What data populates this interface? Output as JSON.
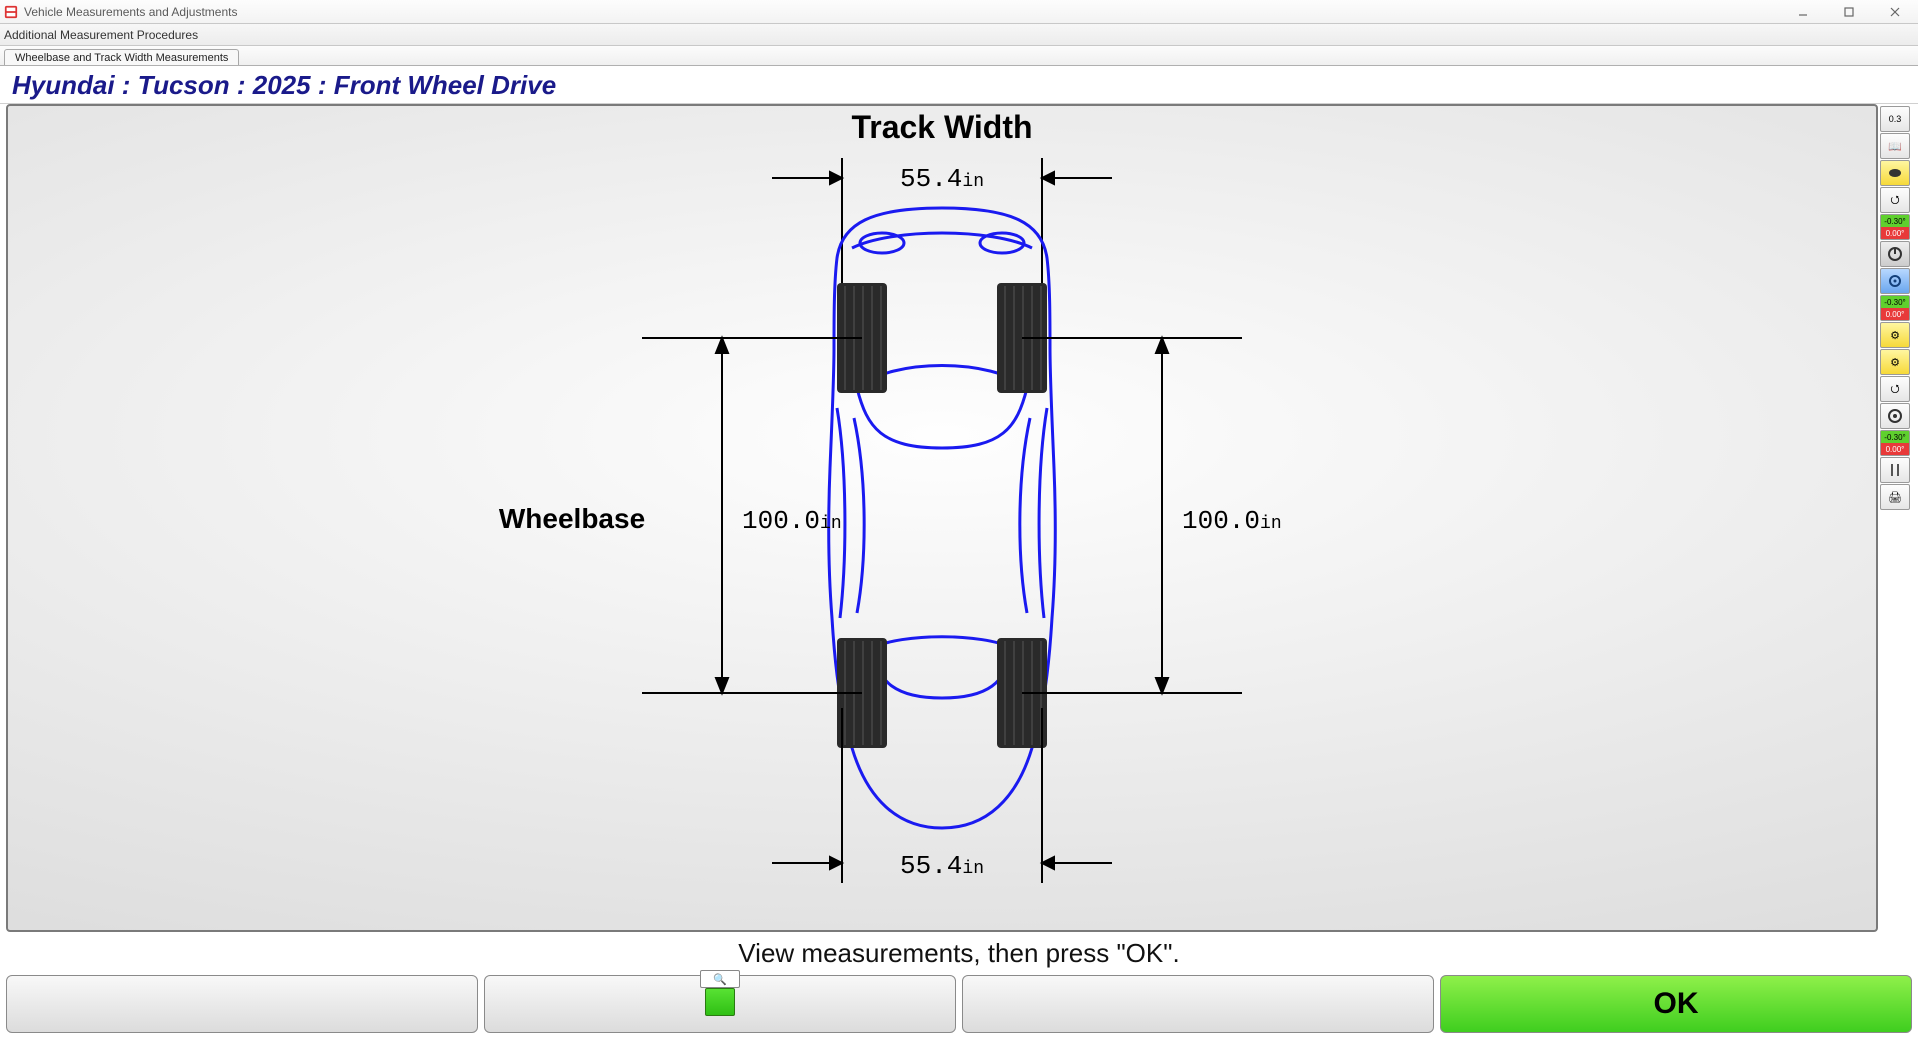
{
  "window": {
    "title": "Vehicle Measurements and Adjustments"
  },
  "menu": {
    "item1": "Additional Measurement Procedures"
  },
  "tab": {
    "label": "Wheelbase and Track Width Measurements"
  },
  "vehicle": {
    "heading": "Hyundai : Tucson : 2025 : Front Wheel Drive"
  },
  "diagram": {
    "track_width_label": "Track Width",
    "wheelbase_label": "Wheelbase",
    "front_track_value": "55.4",
    "front_track_unit": "in",
    "rear_track_value": "55.4",
    "rear_track_unit": "in",
    "left_wheelbase_value": "100.0",
    "left_wheelbase_unit": "in",
    "right_wheelbase_value": "100.0",
    "right_wheelbase_unit": "in"
  },
  "status": {
    "instruction": "View measurements, then press \"OK\"."
  },
  "buttons": {
    "ok": "OK"
  },
  "sidetools": {
    "t1": "0.3",
    "t2": "📖",
    "t4": "⭯",
    "t9": "⚙",
    "t10": "⚙",
    "t11": "⭯",
    "t14": "🖨"
  }
}
